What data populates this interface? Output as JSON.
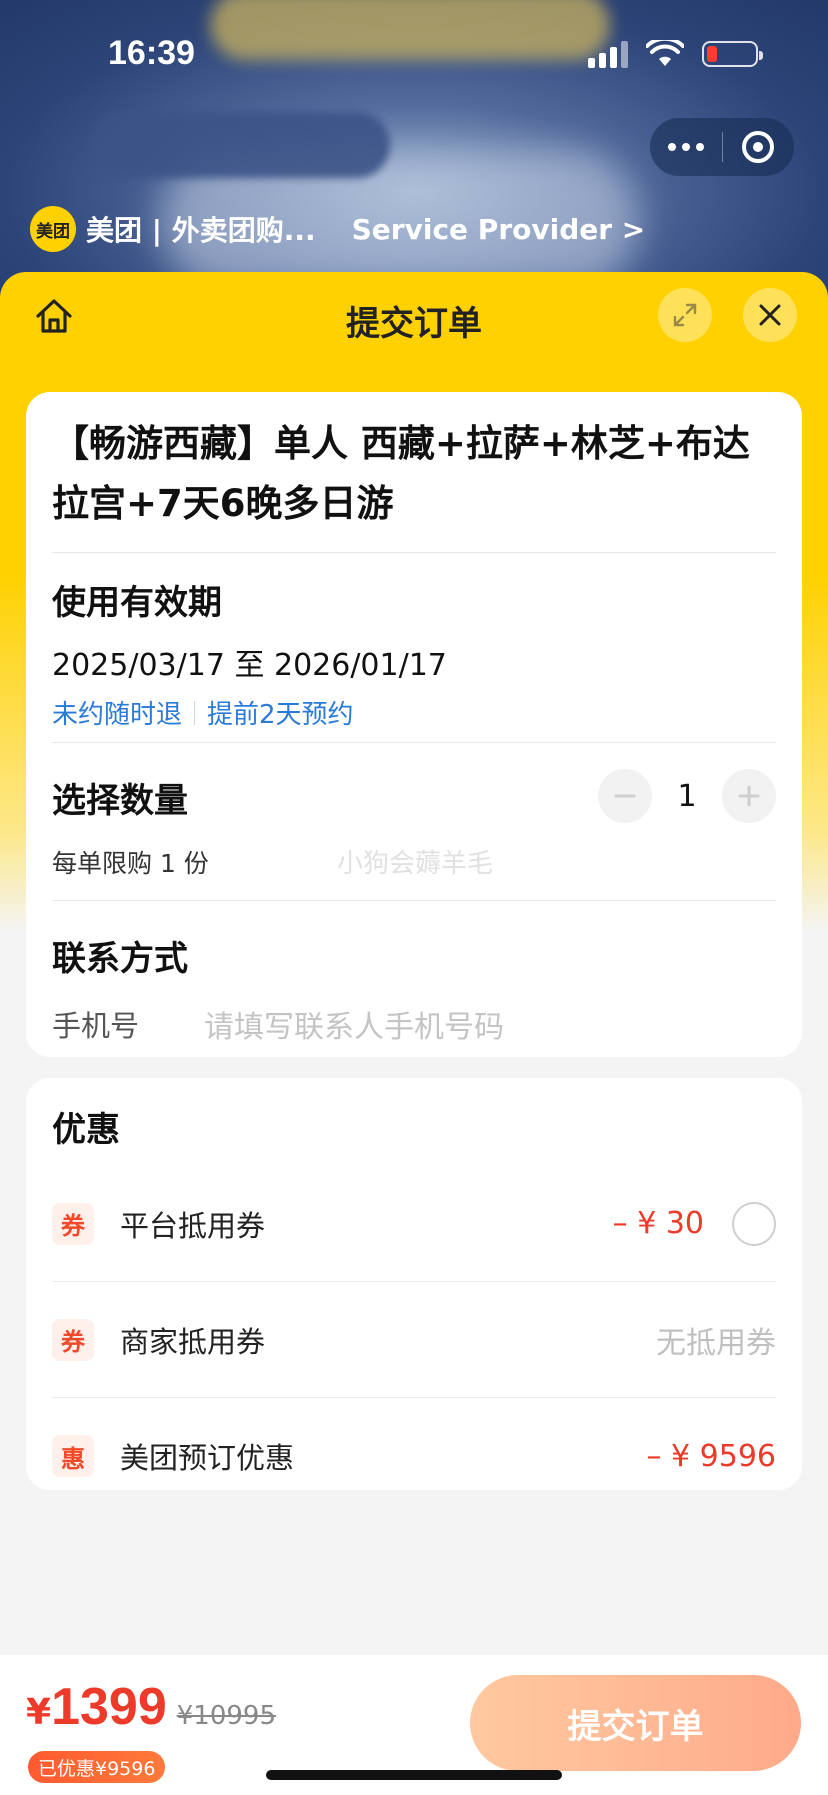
{
  "status_bar": {
    "time": "16:39"
  },
  "provider": {
    "logo_text": "美团",
    "name": "美团 | 外卖团购...",
    "service_link": "Service Provider >"
  },
  "header": {
    "title": "提交订单"
  },
  "product": {
    "title": "【畅游西藏】单人 西藏+拉萨+林芝+布达拉宫+7天6晚多日游"
  },
  "validity": {
    "title": "使用有效期",
    "dates": "2025/03/17 至 2026/01/17",
    "tag_refund": "未约随时退",
    "tag_booking": "提前2天预约"
  },
  "quantity": {
    "title": "选择数量",
    "value": "1",
    "limit": "每单限购 1 份",
    "watermark": "小狗会薅羊毛"
  },
  "contact": {
    "title": "联系方式",
    "phone_label": "手机号",
    "phone_placeholder": "请填写联系人手机号码"
  },
  "discounts": {
    "title": "优惠",
    "rows": [
      {
        "badge": "券",
        "label": "平台抵用券",
        "amount": "– ¥ 30"
      },
      {
        "badge": "券",
        "label": "商家抵用券",
        "amount": "无抵用券"
      },
      {
        "badge": "惠",
        "label": "美团预订优惠",
        "amount": "– ¥ 9596"
      }
    ]
  },
  "bottom": {
    "currency": "¥",
    "price": "1399",
    "original_price": "¥10995",
    "saved": "已优惠¥9596",
    "submit_label": "提交订单"
  },
  "colors": {
    "brand_yellow": "#ffd100",
    "accent_red": "#ee3a2a",
    "link_blue": "#2a7ad8",
    "submit_gradient_start": "#ffc9a0",
    "submit_gradient_end": "#ffaa8a"
  }
}
